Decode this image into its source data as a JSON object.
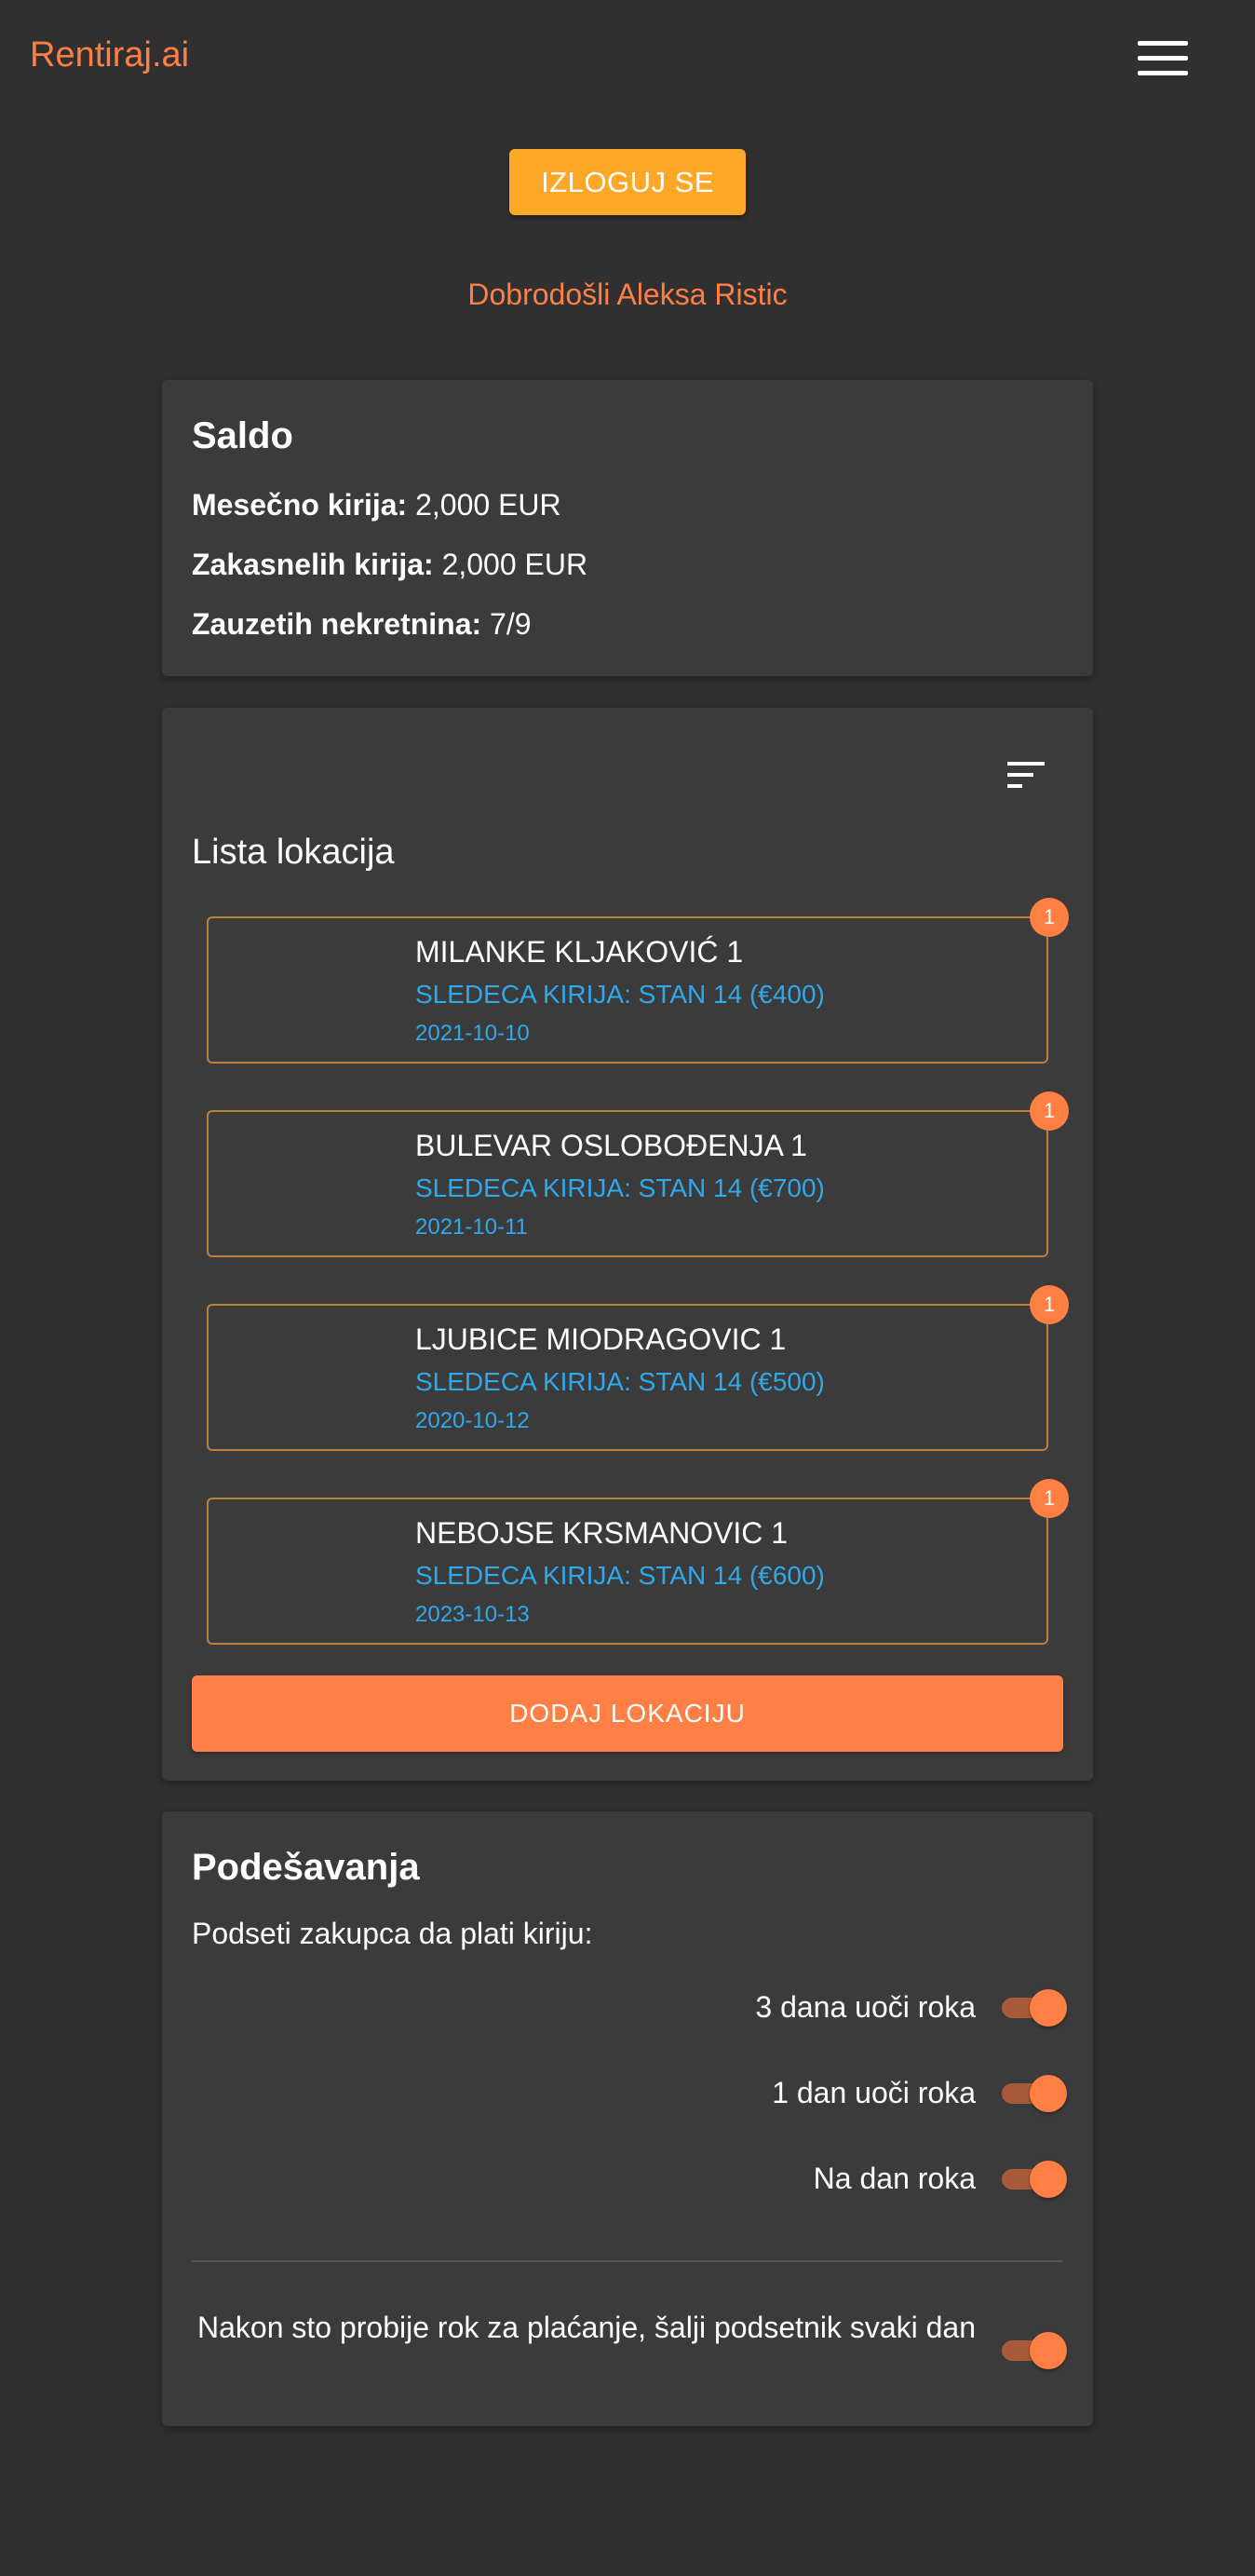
{
  "header": {
    "brand": "Rentiraj.ai",
    "menu_icon": "hamburger-menu-icon",
    "logout_label": "IZLOGUJ SE"
  },
  "welcome": "Dobrodošli Aleksa Ristic",
  "saldo": {
    "title": "Saldo",
    "monthly_label": "Mesečno kirija:",
    "monthly_value": "2,000 EUR",
    "late_label": "Zakasnelih kirija:",
    "late_value": "2,000 EUR",
    "occupied_label": "Zauzetih nekretnina:",
    "occupied_value": "7/9"
  },
  "locations": {
    "sort_icon": "sort-icon",
    "title": "Lista lokacija",
    "items": [
      {
        "name": "MILANKE KLJAKOVIĆ 1",
        "next": "SLEDECA KIRIJA: STAN 14 (€400)",
        "date": "2021-10-10",
        "badge": "1"
      },
      {
        "name": "BULEVAR OSLOBOĐENJA 1",
        "next": "SLEDECA KIRIJA: STAN 14 (€700)",
        "date": "2021-10-11",
        "badge": "1"
      },
      {
        "name": "LJUBICE MIODRAGOVIC 1",
        "next": "SLEDECA KIRIJA: STAN 14 (€500)",
        "date": "2020-10-12",
        "badge": "1"
      },
      {
        "name": "NEBOJSE KRSMANOVIC 1",
        "next": "SLEDECA KIRIJA: STAN 14 (€600)",
        "date": "2023-10-13",
        "badge": "1"
      }
    ],
    "add_label": "DODAJ LOKACIJU"
  },
  "settings": {
    "title": "Podešavanja",
    "remind_label": "Podseti zakupca da plati kiriju:",
    "options": [
      {
        "label": "3 dana uoči roka",
        "enabled": true
      },
      {
        "label": "1 dan uoči roka",
        "enabled": true
      },
      {
        "label": "Na dan roka",
        "enabled": true
      }
    ],
    "daily_label": "Nakon sto probije rok za plaćanje, šalji podsetnik svaki dan",
    "daily_enabled": true
  },
  "colors": {
    "accent": "#ff7f45",
    "logout": "#ffa726",
    "link": "#2fa8ec",
    "background": "#303030",
    "card": "#3b3b3b"
  }
}
